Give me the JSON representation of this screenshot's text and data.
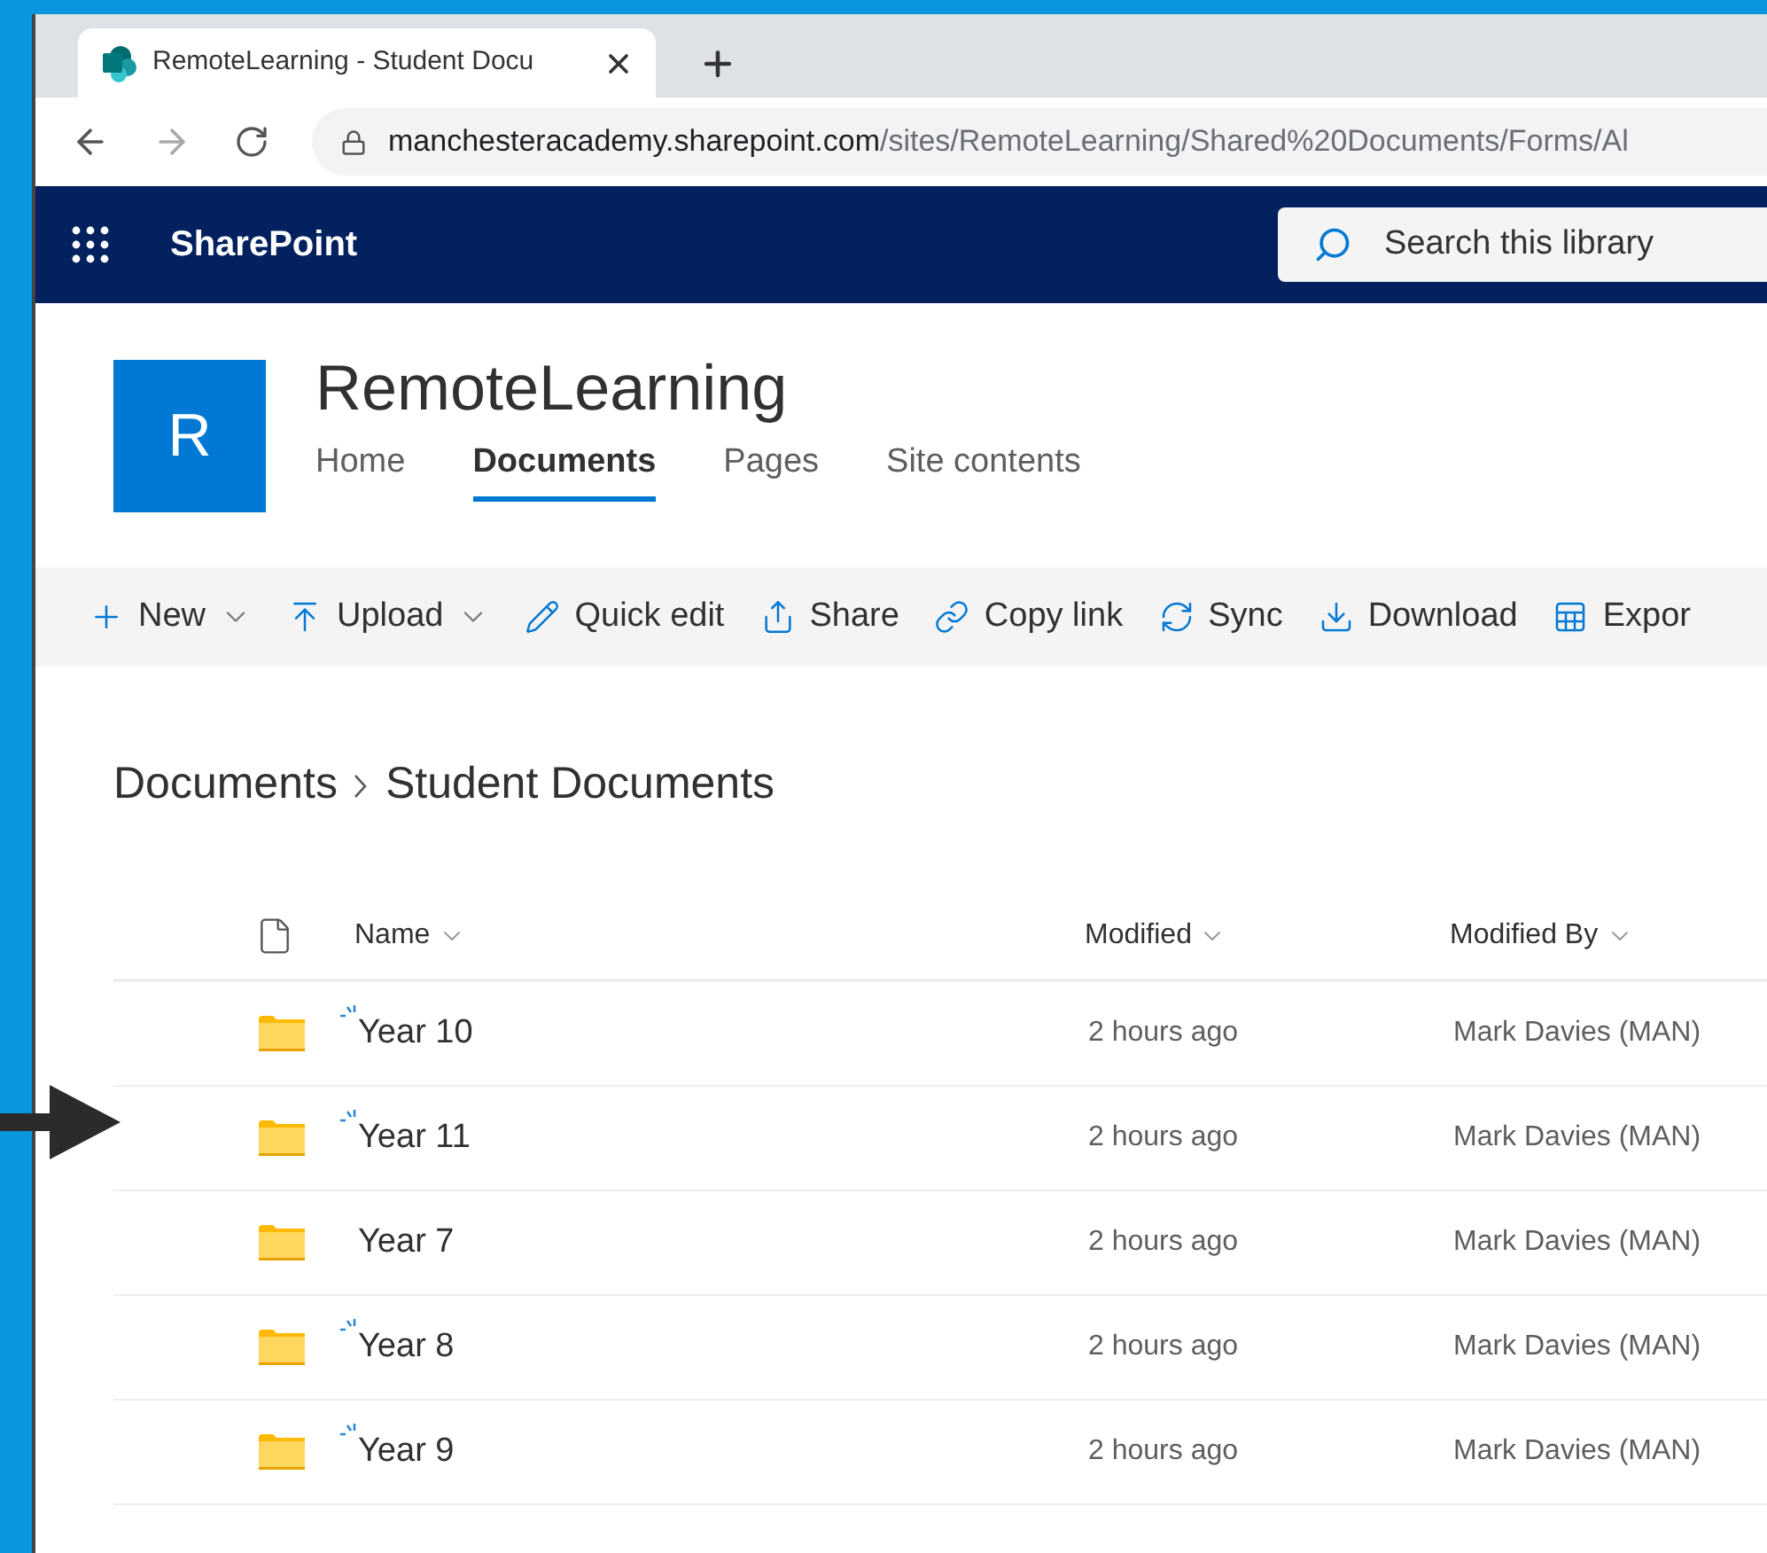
{
  "browser": {
    "tab_title": "RemoteLearning - Student Docu",
    "url_host": "manchesteracademy.sharepoint.com",
    "url_path": "/sites/RemoteLearning/Shared%20Documents/Forms/Al"
  },
  "suite_bar": {
    "app_name": "SharePoint",
    "search": {
      "placeholder": "Search this library"
    }
  },
  "site": {
    "logo_letter": "R",
    "title": "RemoteLearning",
    "nav": [
      {
        "label": "Home",
        "selected": false
      },
      {
        "label": "Documents",
        "selected": true
      },
      {
        "label": "Pages",
        "selected": false
      },
      {
        "label": "Site contents",
        "selected": false
      }
    ]
  },
  "command_bar": [
    {
      "label": "New",
      "kind": "new",
      "dropdown": true
    },
    {
      "label": "Upload",
      "kind": "upload",
      "dropdown": true
    },
    {
      "label": "Quick edit",
      "kind": "edit",
      "dropdown": false
    },
    {
      "label": "Share",
      "kind": "share",
      "dropdown": false
    },
    {
      "label": "Copy link",
      "kind": "link",
      "dropdown": false
    },
    {
      "label": "Sync",
      "kind": "sync",
      "dropdown": false
    },
    {
      "label": "Download",
      "kind": "download",
      "dropdown": false
    },
    {
      "label": "Expor",
      "kind": "export",
      "dropdown": false
    }
  ],
  "breadcrumb": [
    "Documents",
    "Student Documents"
  ],
  "table": {
    "columns": [
      "Name",
      "Modified",
      "Modified By"
    ],
    "rows": [
      {
        "name": "Year 10",
        "new": true,
        "modified": "2 hours ago",
        "modified_by": "Mark Davies (MAN)"
      },
      {
        "name": "Year 11",
        "new": true,
        "modified": "2 hours ago",
        "modified_by": "Mark Davies (MAN)"
      },
      {
        "name": "Year 7",
        "new": false,
        "modified": "2 hours ago",
        "modified_by": "Mark Davies (MAN)"
      },
      {
        "name": "Year 8",
        "new": true,
        "modified": "2 hours ago",
        "modified_by": "Mark Davies (MAN)"
      },
      {
        "name": "Year 9",
        "new": true,
        "modified": "2 hours ago",
        "modified_by": "Mark Davies (MAN)"
      }
    ]
  }
}
